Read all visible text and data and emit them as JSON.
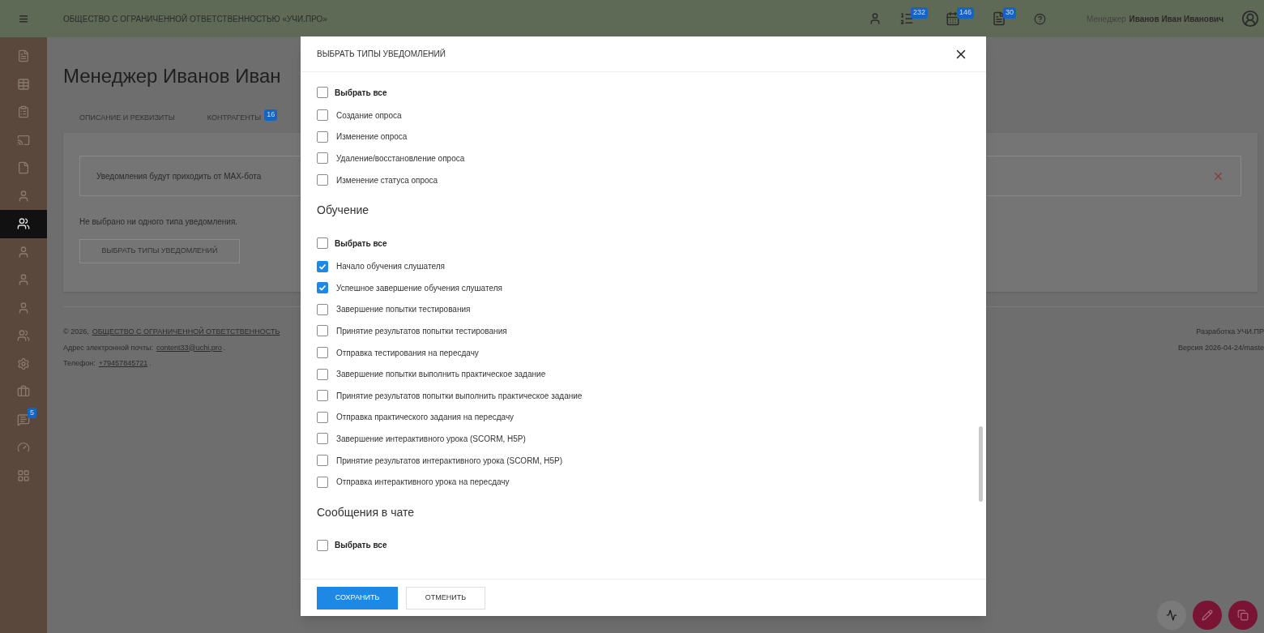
{
  "header": {
    "menu_icon": "≡",
    "org_title": "ОБЩЕСТВО С ОГРАНИЧЕННОЙ ОТВЕТСТВЕННОСТЬЮ «УЧИ.ПРО»",
    "counters": [
      "232",
      "146",
      "30"
    ],
    "user_role": "Менеджер",
    "user_name": "Иванов Иван Иванович"
  },
  "sidebar": {
    "items": [
      {
        "selected": false
      },
      {
        "selected": false
      },
      {
        "selected": false
      },
      {
        "selected": false
      },
      {
        "selected": false
      },
      {
        "selected": false
      },
      {
        "selected": true
      },
      {
        "selected": false
      },
      {
        "selected": false
      },
      {
        "selected": false
      },
      {
        "selected": false
      },
      {
        "selected": false
      },
      {
        "selected": false
      },
      {
        "selected": false,
        "badge": "5"
      },
      {
        "selected": false
      },
      {
        "selected": false
      }
    ]
  },
  "page": {
    "title": "Менеджер Иванов Иван",
    "tabs": [
      {
        "label": "ОПИСАНИЕ И РЕКВИЗИТЫ"
      },
      {
        "label": "КОНТРАГЕНТЫ",
        "badge": "16"
      }
    ],
    "alert": "Уведомления будут приходить от MAX-бота",
    "empty_text": "Не выбрано ни одного типа уведомления.",
    "choose_button": "ВЫБРАТЬ ТИПЫ УВЕДОМЛЕНИЙ"
  },
  "footer": {
    "copyright": "© 2026,",
    "company_link": "ОБЩЕСТВО С ОГРАНИЧЕННОЙ ОТВЕТСТВЕННОСТЬ",
    "email_label": "Адрес электронной почты:",
    "email": "content33@uchi.pro",
    "email_end": ".",
    "phone_label": "Телефон:",
    "phone": "+79457845721",
    "phone_end": ".",
    "developer": "Разработка УЧИ.ПР",
    "version": "Версия 2026-04-24/maste"
  },
  "modal": {
    "title": "ВЫБРАТЬ ТИПЫ УВЕДОМЛЕНИЙ",
    "sections": [
      {
        "select_all": {
          "label": "Выбрать все",
          "checked": false
        },
        "items": [
          {
            "label": "Создание опроса",
            "checked": false
          },
          {
            "label": "Изменение опроса",
            "checked": false
          },
          {
            "label": "Удаление/восстановление опроса",
            "checked": false
          },
          {
            "label": "Изменение статуса опроса",
            "checked": false
          }
        ]
      },
      {
        "heading": "Обучение",
        "select_all": {
          "label": "Выбрать все",
          "checked": false
        },
        "items": [
          {
            "label": "Начало обучения слушателя",
            "checked": true
          },
          {
            "label": "Успешное завершение обучения слушателя",
            "checked": true
          },
          {
            "label": "Завершение попытки тестирования",
            "checked": false
          },
          {
            "label": "Принятие результатов попытки тестирования",
            "checked": false
          },
          {
            "label": "Отправка тестирования на пересдачу",
            "checked": false
          },
          {
            "label": "Завершение попытки выполнить практическое задание",
            "checked": false
          },
          {
            "label": "Принятие результатов попытки выполнить практическое задание",
            "checked": false
          },
          {
            "label": "Отправка практического задания на пересдачу",
            "checked": false
          },
          {
            "label": "Завершение интерактивного урока (SCORM, H5P)",
            "checked": false
          },
          {
            "label": "Принятие результатов интерактивного урока (SCORM, H5P)",
            "checked": false
          },
          {
            "label": "Отправка интерактивного урока на пересдачу",
            "checked": false
          }
        ]
      },
      {
        "heading": "Сообщения в чате",
        "select_all": {
          "label": "Выбрать все",
          "checked": false
        }
      }
    ],
    "buttons": [
      {
        "label": "СОХРАНИТЬ",
        "kind": "primary"
      },
      {
        "label": "ОТМЕНИТЬ",
        "kind": "secondary"
      }
    ]
  }
}
